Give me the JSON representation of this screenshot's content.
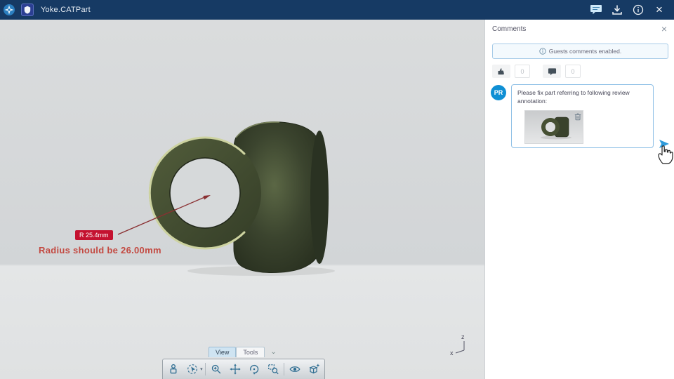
{
  "glyphs": {
    "close": "×",
    "chevron": "⌄"
  },
  "titlebar": {
    "title": "Yoke.CATPart",
    "icons": [
      "compass-icon",
      "app-tile-icon",
      "comments-icon",
      "download-icon",
      "info-icon",
      "close-icon"
    ]
  },
  "viewport": {
    "annotation": {
      "label": "R 25.4mm",
      "note": "Radius should be 26.00mm"
    },
    "axis": {
      "z": "z",
      "x": "x"
    },
    "tabs": {
      "view": "View",
      "tools": "Tools"
    },
    "toolbar_icons": [
      "robot-icon",
      "select-icon",
      "zoom-icon",
      "pan-icon",
      "rotate-icon",
      "zoom-area-icon",
      "eye-icon",
      "cube-add-icon"
    ]
  },
  "panel": {
    "title": "Comments",
    "banner": "Guests comments enabled.",
    "likes": "0",
    "replies": "0",
    "comment": {
      "avatar": "PR",
      "text": "Please fix part referring to following review annotation:"
    }
  },
  "colors": {
    "topbar": "#163a64",
    "accent": "#2f9bdb",
    "annotation_red": "#c41230",
    "part_green": "#3c4531"
  }
}
